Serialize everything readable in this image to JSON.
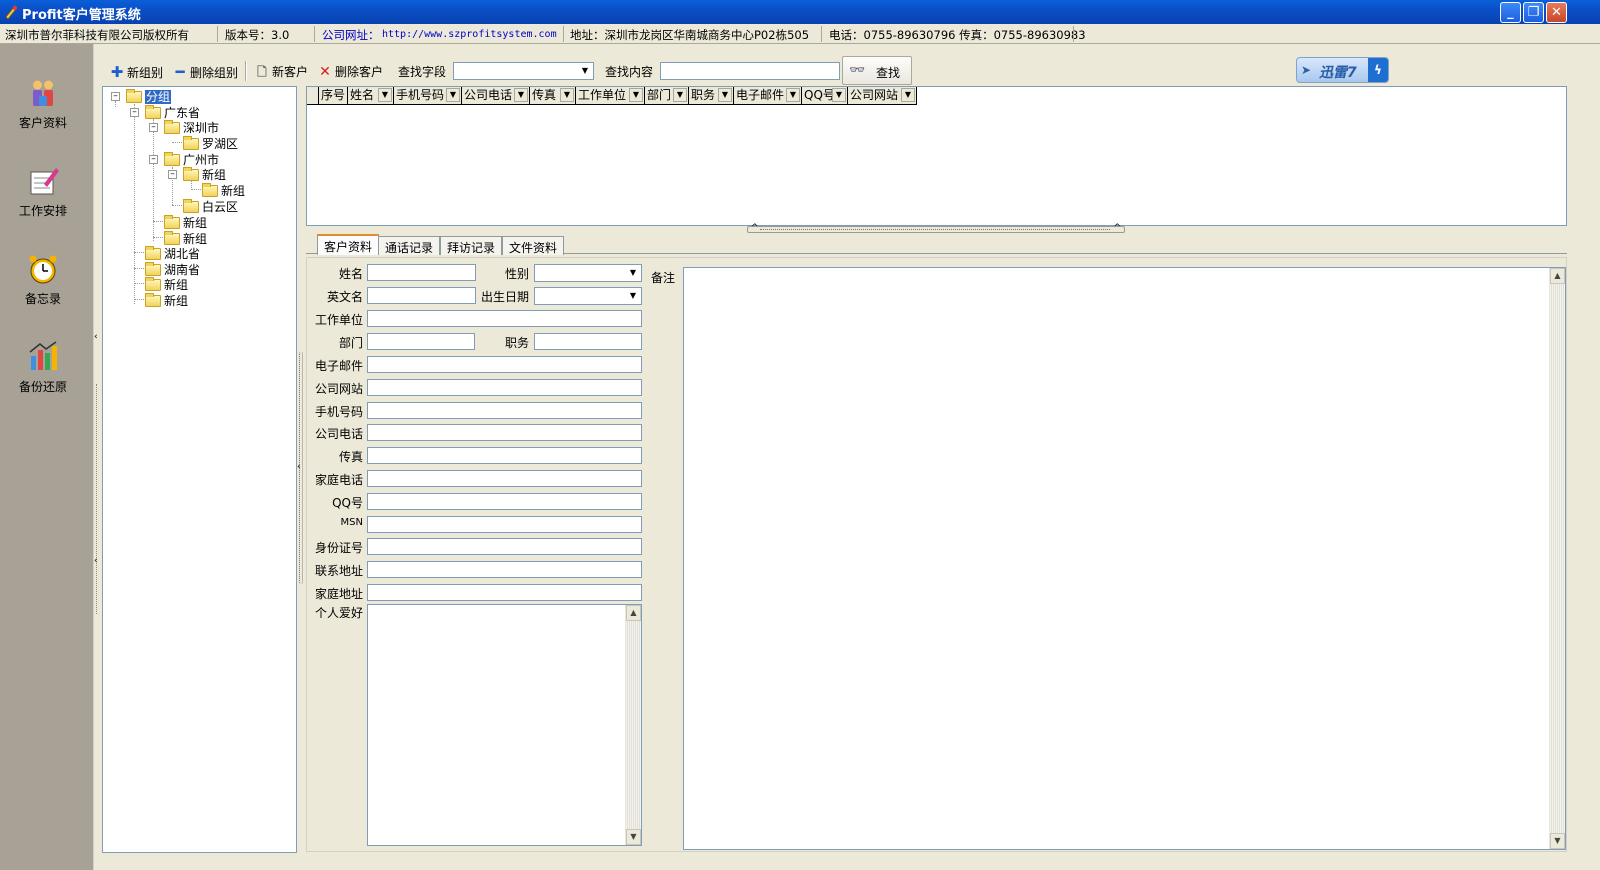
{
  "window": {
    "title": "Profit客户管理系统",
    "minimize": "_",
    "restore": "❐",
    "close": "✕"
  },
  "infobar": {
    "copyright": "深圳市普尔菲科技有限公司版权所有",
    "version": "版本号：3.0",
    "website_label": "公司网址：",
    "website_url": "http://www.szprofitsystem.com",
    "address": "地址：深圳市龙岗区华南城商务中心P02栋505",
    "phone": "电话：0755-89630796  传真：0755-89630983"
  },
  "nav": [
    {
      "label": "客户资料",
      "icon": "customer-icon"
    },
    {
      "label": "工作安排",
      "icon": "schedule-icon"
    },
    {
      "label": "备忘录",
      "icon": "alarm-clock-icon"
    },
    {
      "label": "备份还原",
      "icon": "backup-icon"
    }
  ],
  "toolbar": {
    "new_group": "新组别",
    "delete_group": "删除组别",
    "new_customer": "新客户",
    "delete_customer": "删除客户",
    "search_field_label": "查找字段",
    "search_field_value": "",
    "search_content_label": "查找内容",
    "search_content_value": "",
    "find": "查找",
    "xunlei": "迅雷7"
  },
  "tree": {
    "root": "分组",
    "nodes": [
      {
        "label": "广东省"
      },
      {
        "label": "深圳市"
      },
      {
        "label": "罗湖区"
      },
      {
        "label": "广州市"
      },
      {
        "label": "新组"
      },
      {
        "label": "新组"
      },
      {
        "label": "白云区"
      },
      {
        "label": "新组"
      },
      {
        "label": "新组"
      },
      {
        "label": "湖北省"
      },
      {
        "label": "湖南省"
      },
      {
        "label": "新组"
      },
      {
        "label": "新组"
      }
    ]
  },
  "grid": {
    "columns": [
      "序号",
      "姓名",
      "手机号码",
      "公司电话",
      "传真",
      "工作单位",
      "部门",
      "职务",
      "电子邮件",
      "QQ号",
      "公司网站"
    ]
  },
  "tabs": [
    "客户资料",
    "通话记录",
    "拜访记录",
    "文件资料"
  ],
  "form": {
    "name": "姓名",
    "gender": "性别",
    "english_name": "英文名",
    "birthday": "出生日期",
    "company": "工作单位",
    "department": "部门",
    "position": "职务",
    "email": "电子邮件",
    "website": "公司网站",
    "mobile": "手机号码",
    "company_phone": "公司电话",
    "fax": "传真",
    "home_phone": "家庭电话",
    "qq": "QQ号",
    "msn": "MSN",
    "id_number": "身份证号",
    "contact_address": "联系地址",
    "home_address": "家庭地址",
    "hobbies": "个人爱好",
    "remarks": "备注"
  }
}
